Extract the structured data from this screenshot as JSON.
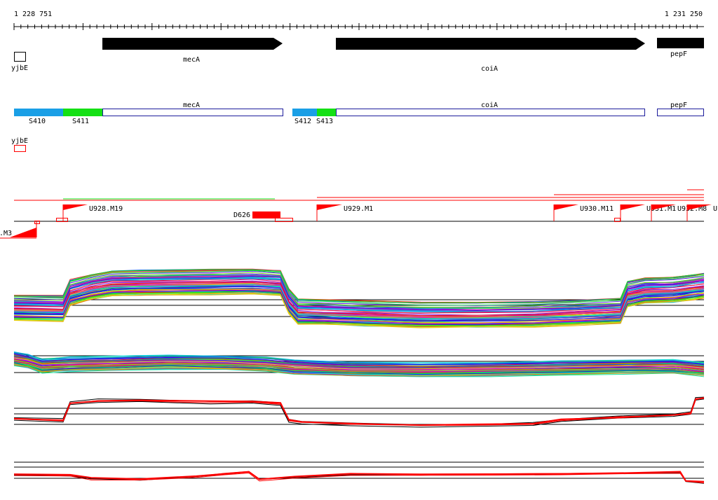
{
  "ruler": {
    "start_label": "1 228 751",
    "end_label": "1 231 250",
    "start": 1228751,
    "end": 1231250
  },
  "genes": [
    {
      "label": "mecA",
      "start": 1229065,
      "end": 1229722,
      "strand": "+"
    },
    {
      "label": "coiA",
      "start": 1230106,
      "end": 1231217,
      "strand": "+"
    },
    {
      "label": "pepF",
      "start": 1231260,
      "end": 1231420,
      "strand": "+"
    }
  ],
  "left_gene": {
    "label": "yjbE"
  },
  "segments": [
    {
      "label": "S410",
      "start": 1228751,
      "end": 1228926,
      "color": "#1a9fe6"
    },
    {
      "label": "S411",
      "start": 1228926,
      "end": 1229065,
      "color": "#14e014"
    },
    {
      "label": "S412",
      "start": 1229785,
      "end": 1229874,
      "color": "#1a9fe6"
    },
    {
      "label": "S413",
      "start": 1229874,
      "end": 1229940,
      "color": "#14e014"
    }
  ],
  "segment_genes": [
    {
      "label": "mecA",
      "start": 1229065,
      "end": 1229722
    },
    {
      "label": "coiA",
      "start": 1229940,
      "end": 1231217
    },
    {
      "label": "pepF",
      "start": 1231260,
      "end": 1231420
    }
  ],
  "left_segment_gene": {
    "label": "yjbE"
  },
  "features": [
    {
      "label": "U928.M19",
      "start": 1228926
    },
    {
      "label": "D626",
      "start": 1229652
    },
    {
      "label": "U929.M1",
      "start": 1229857
    },
    {
      "label": "U930.M11",
      "start": 1230749
    },
    {
      "label": "U931.M1",
      "start": 1230929
    },
    {
      "label": "U932.M8",
      "start": 1231024
    },
    {
      "label": "U",
      "start": 1231155
    },
    {
      "label": ".M3",
      "start": 1228700
    }
  ],
  "colors": {
    "gene": "#000000",
    "feature": "#ff0000",
    "segment_outline": "#1c1c9c",
    "red": "#ff0000"
  }
}
